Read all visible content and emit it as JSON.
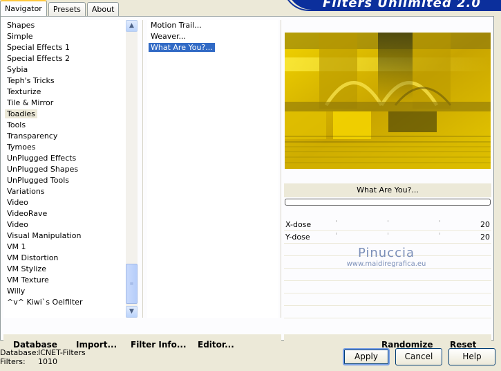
{
  "banner": {
    "title": "Filters Unlimited 2.0"
  },
  "tabs": [
    "Navigator",
    "Presets",
    "About"
  ],
  "categories": [
    "Shapes",
    "Simple",
    "Special Effects 1",
    "Special Effects 2",
    "Sybia",
    "Teph's Tricks",
    "Texturize",
    "Tile & Mirror",
    "Toadies",
    "Tools",
    "Transparency",
    "Tymoes",
    "UnPlugged Effects",
    "UnPlugged Shapes",
    "UnPlugged Tools",
    "Variations",
    "Video",
    "VideoRave",
    "Video",
    "Visual Manipulation",
    "VM 1",
    "VM Distortion",
    "VM Stylize",
    "VM Texture",
    "Willy",
    "^v^ Kiwi`s Oelfilter"
  ],
  "selected_category": "Toadies",
  "filters": [
    "Motion Trail...",
    "Weaver...",
    "What Are You?..."
  ],
  "selected_filter": "What Are You?...",
  "preview": {
    "label": "What Are You?..."
  },
  "params": [
    {
      "label": "X-dose",
      "value": "20"
    },
    {
      "label": "Y-dose",
      "value": "20"
    }
  ],
  "watermark": {
    "name": "Pinuccia",
    "url": "www.maidiregrafica.eu"
  },
  "left_buttons": {
    "database": "Database",
    "import": "Import...",
    "filter_info": "Filter Info...",
    "editor": "Editor..."
  },
  "right_buttons": {
    "randomize": "Randomize",
    "reset": "Reset"
  },
  "status": {
    "database_label": "Database:",
    "database_value": "ICNET-Filters",
    "filters_label": "Filters:",
    "filters_value": "1010"
  },
  "dialog_buttons": {
    "apply": "Apply",
    "cancel": "Cancel",
    "help": "Help"
  },
  "colors": {
    "selection": "#316ac5",
    "banner": "#0b2f9c",
    "face": "#ece9d8"
  }
}
